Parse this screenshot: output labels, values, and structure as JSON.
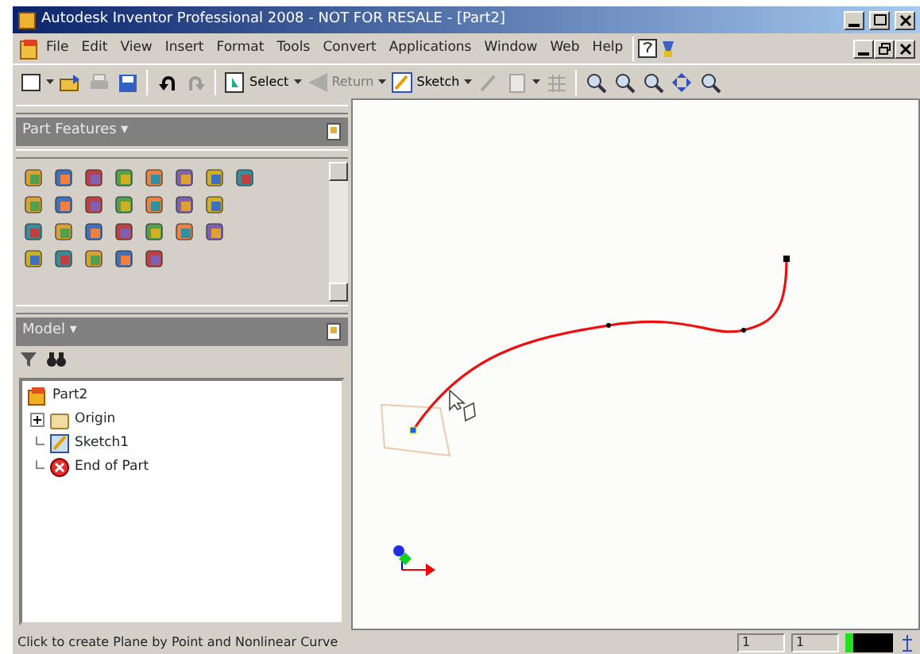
{
  "window": {
    "title": "Autodesk Inventor Professional 2008 - NOT FOR RESALE - [Part2]"
  },
  "menu": [
    "File",
    "Edit",
    "View",
    "Insert",
    "Format",
    "Tools",
    "Convert",
    "Applications",
    "Window",
    "Web",
    "Help"
  ],
  "toolbar": [
    {
      "kind": "new",
      "disabled": false
    },
    {
      "kind": "caret"
    },
    {
      "kind": "open",
      "disabled": false
    },
    {
      "kind": "print",
      "disabled": true
    },
    {
      "kind": "save",
      "disabled": false
    },
    {
      "kind": "sep"
    },
    {
      "kind": "undo",
      "disabled": false
    },
    {
      "kind": "redo",
      "disabled": true
    },
    {
      "kind": "sep"
    },
    {
      "kind": "select",
      "label": "Select",
      "disabled": false
    },
    {
      "kind": "caret"
    },
    {
      "kind": "return",
      "label": "Return",
      "disabled": true
    },
    {
      "kind": "caret"
    },
    {
      "kind": "sketch",
      "label": "Sketch",
      "disabled": false
    },
    {
      "kind": "caret"
    },
    {
      "kind": "pen",
      "disabled": true
    },
    {
      "kind": "doc",
      "disabled": true
    },
    {
      "kind": "caret"
    },
    {
      "kind": "grid",
      "disabled": true
    },
    {
      "kind": "sep"
    },
    {
      "kind": "zoom",
      "disabled": false
    },
    {
      "kind": "zoom",
      "disabled": false
    },
    {
      "kind": "zoom",
      "disabled": false
    },
    {
      "kind": "pan",
      "disabled": false
    },
    {
      "kind": "zoom",
      "disabled": false
    }
  ],
  "features_panel": {
    "title": "Part Features ▾"
  },
  "model_panel": {
    "title": "Model ▾",
    "tree": [
      {
        "label": "Part2",
        "kind": "part",
        "children": [
          {
            "label": "Origin",
            "kind": "folder",
            "expanded": false
          },
          {
            "label": "Sketch1",
            "kind": "sketch"
          },
          {
            "label": "End of Part",
            "kind": "end"
          }
        ]
      }
    ]
  },
  "status_bar": {
    "message": "Click to create Plane by Point and Nonlinear Curve",
    "fields": [
      "1",
      "1"
    ]
  }
}
